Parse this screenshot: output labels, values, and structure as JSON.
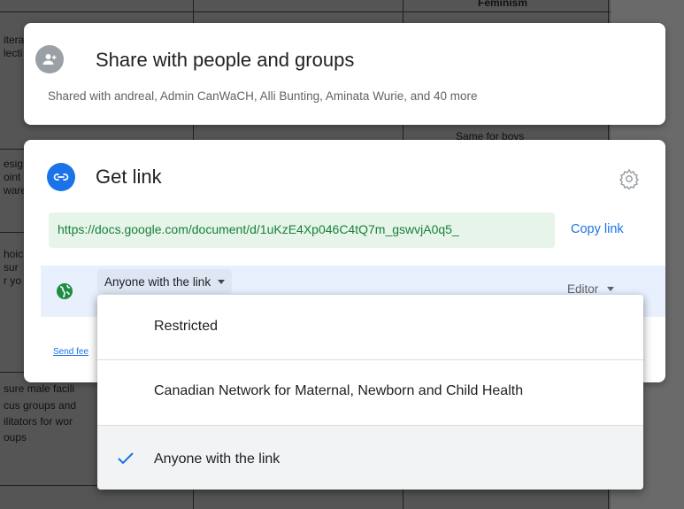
{
  "background_doc": {
    "fragments": [
      "Feminism",
      "itera",
      "lecti",
      "Same for boys",
      "esig",
      "oint",
      "ware",
      "hoic",
      "sur",
      "r yo",
      "sure male facili",
      "cus groups and",
      "ilitators for wor",
      "oups"
    ]
  },
  "share": {
    "title": "Share with people and groups",
    "subtitle": "Shared with andreal, Admin CanWaCH, Alli Bunting, Aminata Wurie, and 40 more",
    "icon": "person-add-icon"
  },
  "get_link": {
    "title": "Get link",
    "icon": "link-icon",
    "url": "https://docs.google.com/document/d/1uKzE4Xp046C4tQ7m_gswvjA0q5_",
    "copy_label": "Copy link",
    "settings_icon": "gear-icon",
    "access_label": "Anyone with the link",
    "role_label": "Editor",
    "send_feedback": "Send fee"
  },
  "menu": {
    "items": [
      {
        "label": "Restricted",
        "selected": false
      },
      {
        "label": "Canadian Network for Maternal, Newborn and Child Health",
        "selected": false
      },
      {
        "label": "Anyone with the link",
        "selected": true
      }
    ]
  },
  "colors": {
    "accent": "#1a73e8",
    "link_green": "#188038",
    "globe_green": "#1e8e3e"
  }
}
